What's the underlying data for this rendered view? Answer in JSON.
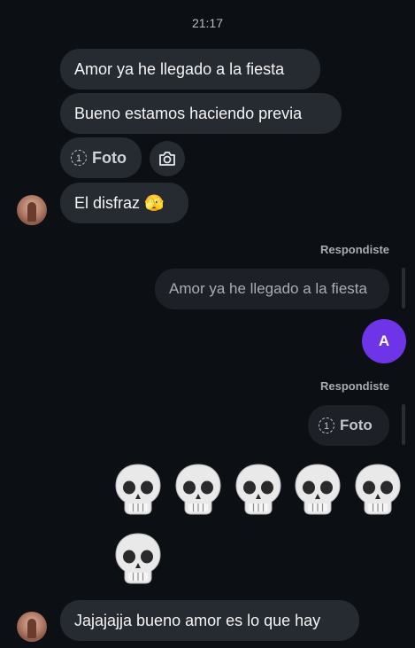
{
  "timestamp": "21:17",
  "messages": {
    "m1": "Amor ya he llegado a la fiesta",
    "m2": "Bueno estamos haciendo previa",
    "photo_label": "Foto",
    "photo_once_badge": "1",
    "m3": "El disfraz 🫣",
    "replied_label_1": "Respondiste",
    "reply_quote_1": "Amor ya he llegado a la fiesta",
    "me_avatar_letter": "A",
    "replied_label_2": "Respondiste",
    "reply_photo_label": "Foto",
    "reply_photo_badge": "1",
    "m_last": "Jajajajja bueno amor es lo que hay"
  },
  "skull_count": 6,
  "icons": [
    "view-once-icon",
    "camera-icon",
    "skull-emoji"
  ],
  "colors": {
    "background": "#0c0f14",
    "bubble": "#262a31",
    "accent": "#6e35e8"
  }
}
